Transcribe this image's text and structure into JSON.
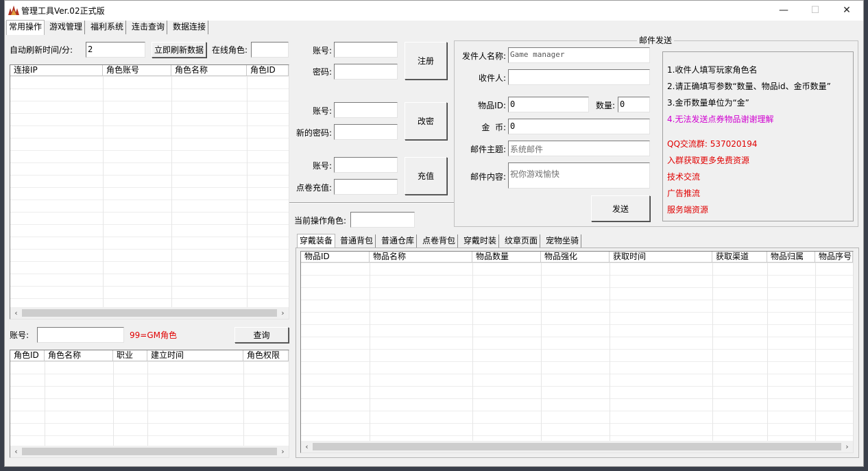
{
  "window": {
    "title": "管理工具Ver.02正式版",
    "minimize_glyph": "—",
    "maximize_glyph": "☐",
    "close_glyph": "✕"
  },
  "main_tabs": [
    "常用操作",
    "游戏管理",
    "福利系统",
    "连击查询",
    "数据连接"
  ],
  "refresh": {
    "label": "自动刷新时间/分:",
    "value": "2",
    "refresh_button": "立即刷新数据",
    "online_label": "在线角色:",
    "online_value": ""
  },
  "online_table": {
    "columns": [
      "连接IP",
      "角色账号",
      "角色名称",
      "角色ID"
    ]
  },
  "query": {
    "account_label": "账号:",
    "account_value": "",
    "gm_note": "99=GM角色",
    "query_button": "查询"
  },
  "role_table": {
    "columns": [
      "角色ID",
      "角色名称",
      "职业",
      "建立时间",
      "角色权限"
    ]
  },
  "register": {
    "account_label": "账号:",
    "password_label": "密码:",
    "button": "注册"
  },
  "change_password": {
    "account_label": "账号:",
    "new_password_label": "新的密码:",
    "button": "改密"
  },
  "recharge": {
    "account_label": "账号:",
    "points_label": "点卷充值:",
    "button": "充值"
  },
  "current_role": {
    "label": "当前操作角色:",
    "value": ""
  },
  "mail": {
    "group_title": "邮件发送",
    "sender_label": "发件人名称:",
    "sender_value": "Game manager",
    "recipient_label": "收件人:",
    "recipient_value": "",
    "item_id_label": "物品ID:",
    "item_id_value": "0",
    "quantity_label": "数量:",
    "quantity_value": "0",
    "gold_label": "金  币:",
    "gold_value": "0",
    "subject_label": "邮件主题:",
    "subject_value": "系统邮件",
    "content_label": "邮件内容:",
    "content_value": "祝你游戏愉快",
    "send_button": "发送"
  },
  "notes": {
    "line1": "1.收件人填写玩家角色名",
    "line2": "2.请正确填写参数“数量、物品id、金币数量”",
    "line3": "3.金币数量单位为“金”",
    "line4": "4.无法发送点券物品谢谢理解",
    "qq": "QQ交流群: 537020194",
    "promo1": "入群获取更多免费资源",
    "promo2": "技术交流",
    "promo3": "广告推流",
    "promo4": "服务端资源"
  },
  "item_tabs": [
    "穿戴装备",
    "普通背包",
    "普通仓库",
    "点卷背包",
    "穿戴时装",
    "纹章页面",
    "宠物坐骑"
  ],
  "item_table": {
    "columns": [
      "物品ID",
      "物品名称",
      "物品数量",
      "物品强化",
      "获取时间",
      "获取渠道",
      "物品归属",
      "物品序号"
    ]
  },
  "colors": {
    "red_text": "#e00000",
    "magenta_text": "#d000d0",
    "window_bg": "#f0f0f0"
  }
}
